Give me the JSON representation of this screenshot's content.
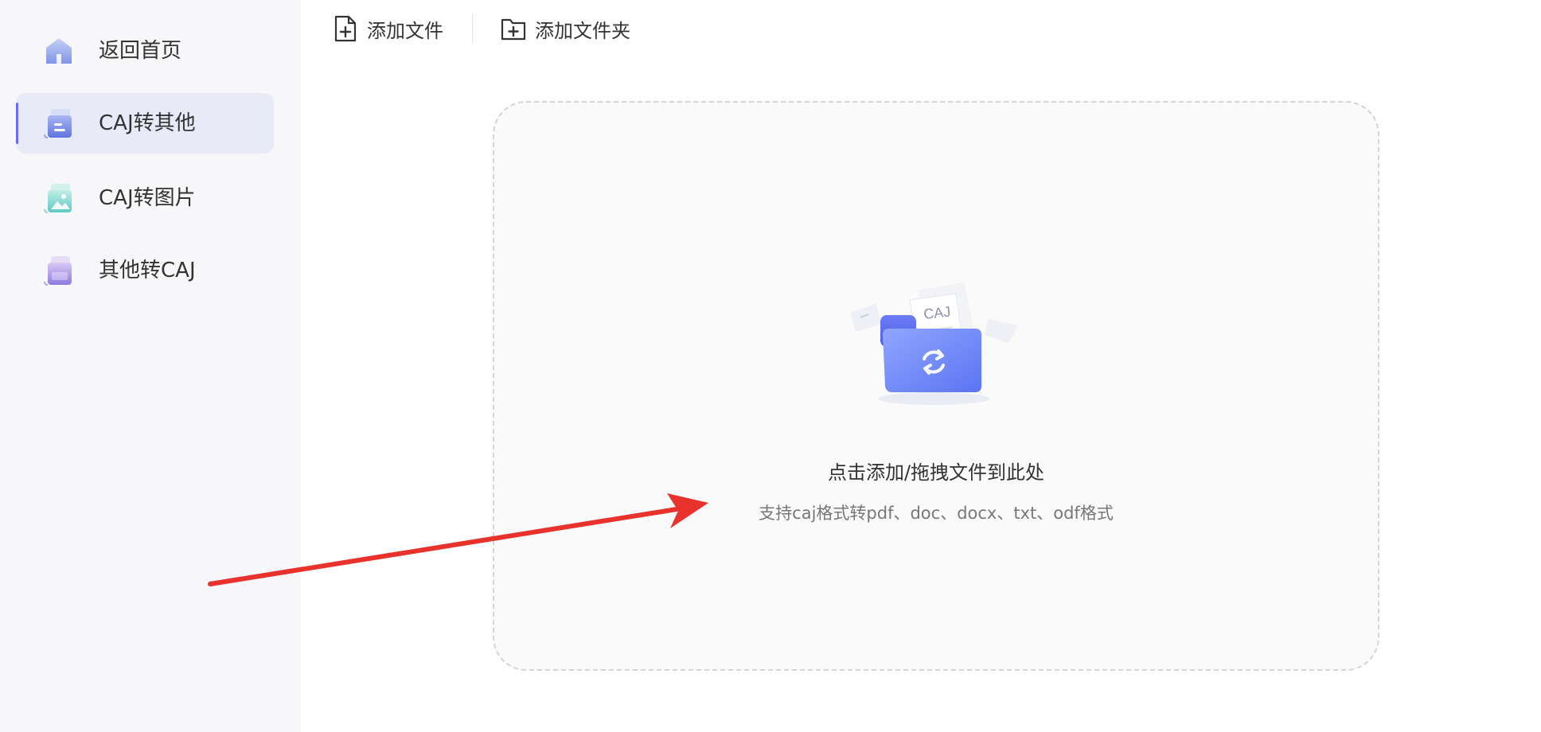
{
  "sidebar": {
    "items": [
      {
        "label": "返回首页",
        "icon": "home-icon",
        "active": false
      },
      {
        "label": "CAJ转其他",
        "icon": "caj-convert-icon",
        "active": true
      },
      {
        "label": "CAJ转图片",
        "icon": "image-icon",
        "active": false
      },
      {
        "label": "其他转CAJ",
        "icon": "to-caj-icon",
        "active": false
      }
    ]
  },
  "toolbar": {
    "add_file_label": "添加文件",
    "add_folder_label": "添加文件夹"
  },
  "dropzone": {
    "title": "点击添加/拖拽文件到此处",
    "subtitle": "支持caj格式转pdf、doc、docx、txt、odf格式",
    "illustration_label": "CAJ"
  },
  "colors": {
    "accent": "#6a6df0",
    "active_bg": "#e9eaf8",
    "annotation_arrow": "#e8322b"
  }
}
